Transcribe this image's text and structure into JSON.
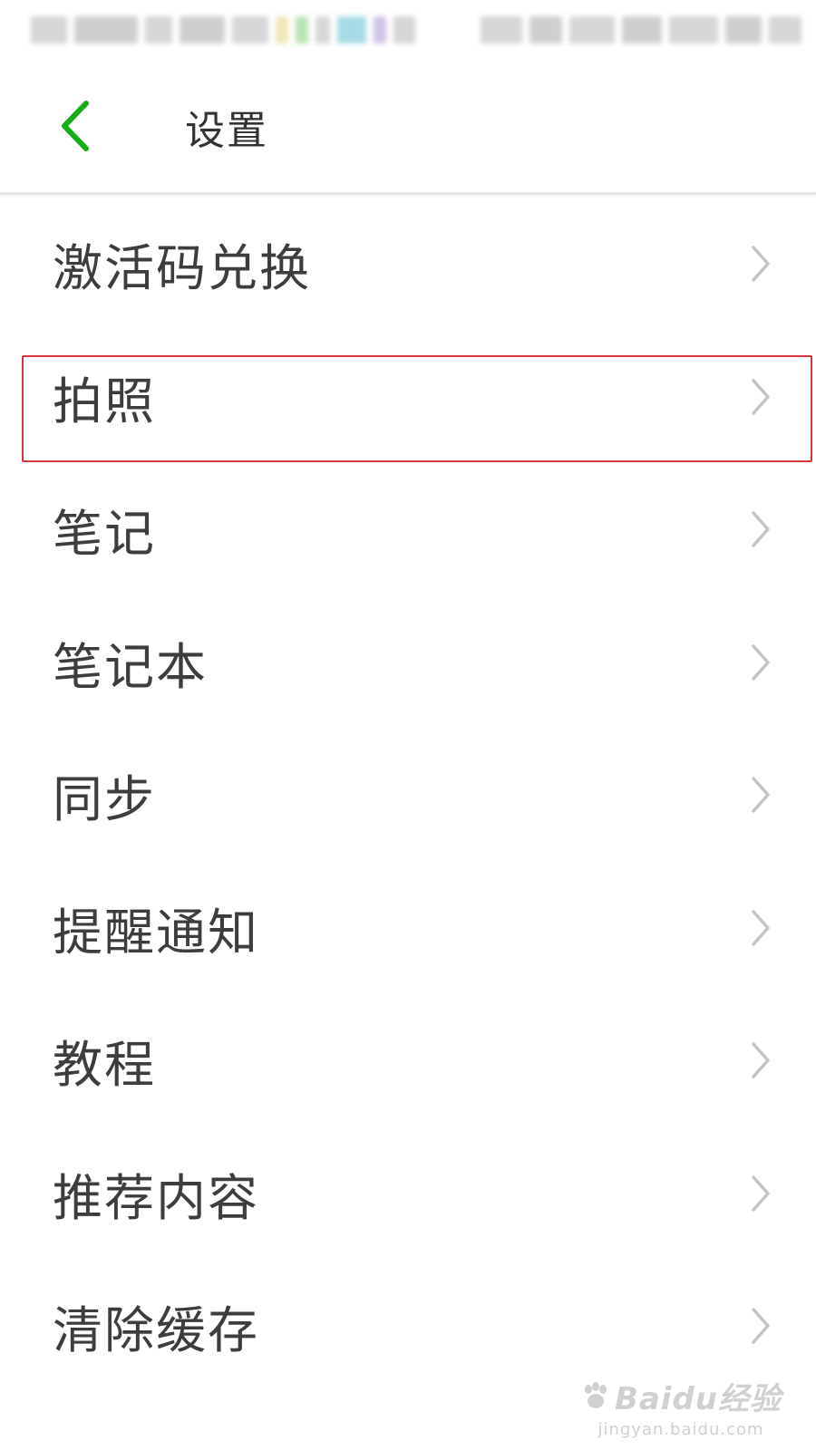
{
  "header": {
    "title": "设置",
    "back_icon": "chevron-left-icon",
    "accent_color": "#1aad19"
  },
  "settings_items": [
    {
      "label": "激活码兑换",
      "icon": "chevron-right-icon"
    },
    {
      "label": "拍照",
      "icon": "chevron-right-icon",
      "highlighted": true
    },
    {
      "label": "笔记",
      "icon": "chevron-right-icon"
    },
    {
      "label": "笔记本",
      "icon": "chevron-right-icon"
    },
    {
      "label": "同步",
      "icon": "chevron-right-icon"
    },
    {
      "label": "提醒通知",
      "icon": "chevron-right-icon"
    },
    {
      "label": "教程",
      "icon": "chevron-right-icon"
    },
    {
      "label": "推荐内容",
      "icon": "chevron-right-icon"
    },
    {
      "label": "清除缓存",
      "icon": "chevron-right-icon"
    }
  ],
  "highlight_color": "#d9363e",
  "watermark": {
    "brand": "Baidu经验",
    "url": "jingyan.baidu.com"
  }
}
